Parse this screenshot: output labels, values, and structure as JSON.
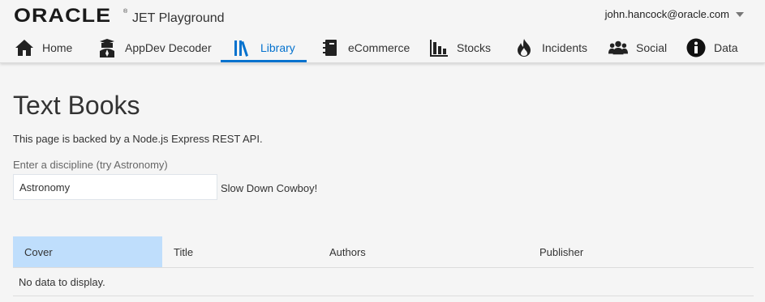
{
  "header": {
    "brand": "ORACLE",
    "trademark": "®",
    "app_name": "JET Playground",
    "user": "john.hancock@oracle.com"
  },
  "nav": {
    "items": [
      {
        "label": "Home",
        "icon": "home-icon"
      },
      {
        "label": "AppDev Decoder",
        "icon": "graduate-icon"
      },
      {
        "label": "Library",
        "icon": "library-icon",
        "selected": true
      },
      {
        "label": "eCommerce",
        "icon": "notebook-icon"
      },
      {
        "label": "Stocks",
        "icon": "bar-chart-icon"
      },
      {
        "label": "Incidents",
        "icon": "fire-icon"
      },
      {
        "label": "Social",
        "icon": "people-icon"
      },
      {
        "label": "Data",
        "icon": "info-icon"
      }
    ]
  },
  "page": {
    "title": "Text Books",
    "description": "This page is backed by a Node.js Express REST API.",
    "search_label": "Enter a discipline (try Astronomy)",
    "search_value": "Astronomy",
    "status": "Slow Down Cowboy!"
  },
  "table": {
    "columns": [
      "Cover",
      "Title",
      "Authors",
      "Publisher"
    ],
    "empty_text": "No data to display."
  },
  "colors": {
    "accent": "#0572ce",
    "selected_header": "#bfdefc"
  }
}
